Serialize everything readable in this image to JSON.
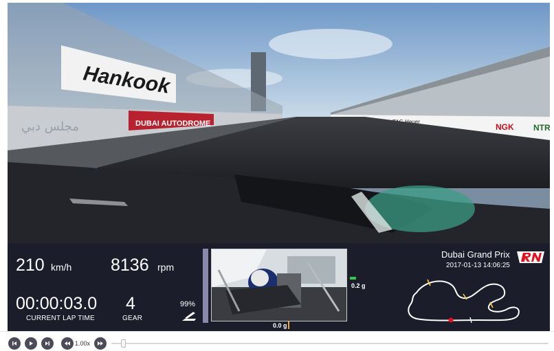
{
  "telemetry": {
    "speed_value": "210",
    "speed_unit": "km/h",
    "rpm_value": "8136",
    "rpm_unit": "rpm",
    "lap_time_value": "00:00:03.0",
    "lap_time_label": "CURRENT LAP TIME",
    "gear_value": "4",
    "gear_label": "GEAR",
    "throttle_value": "99%",
    "lateral_g": "0.0 g",
    "longitudinal_g": "0.2 g"
  },
  "event": {
    "name": "Dubai Grand Prix",
    "datetime": "2017-01-13 14:06:25",
    "logo_text": "RN"
  },
  "video_signage": {
    "sponsor_main": "Hankook",
    "sponsor_autodrome": "DUBAI AUTODROME",
    "sponsor_ngk": "NGK",
    "sponsor_ntr": "NTR",
    "sponsor_tagheuer": "TAG Heuer",
    "sponsor_arabic": "مجلس دبي"
  },
  "playback": {
    "speed_label": "1.00x"
  },
  "colors": {
    "panel_bg": "#1c1d2b",
    "accent_bar": "#8c87ac",
    "lateral_g_indicator": "#f5a623",
    "longitudinal_g_indicator": "#2ecc40",
    "track_position_marker": "#e8101e",
    "button_bg": "#4b4c58"
  },
  "icons": {
    "throttle": "pedal-icon",
    "skip_back": "skip-back-icon",
    "play": "play-icon",
    "skip_forward": "skip-forward-icon",
    "rewind": "rewind-icon",
    "fast_forward": "fast-forward-icon"
  }
}
